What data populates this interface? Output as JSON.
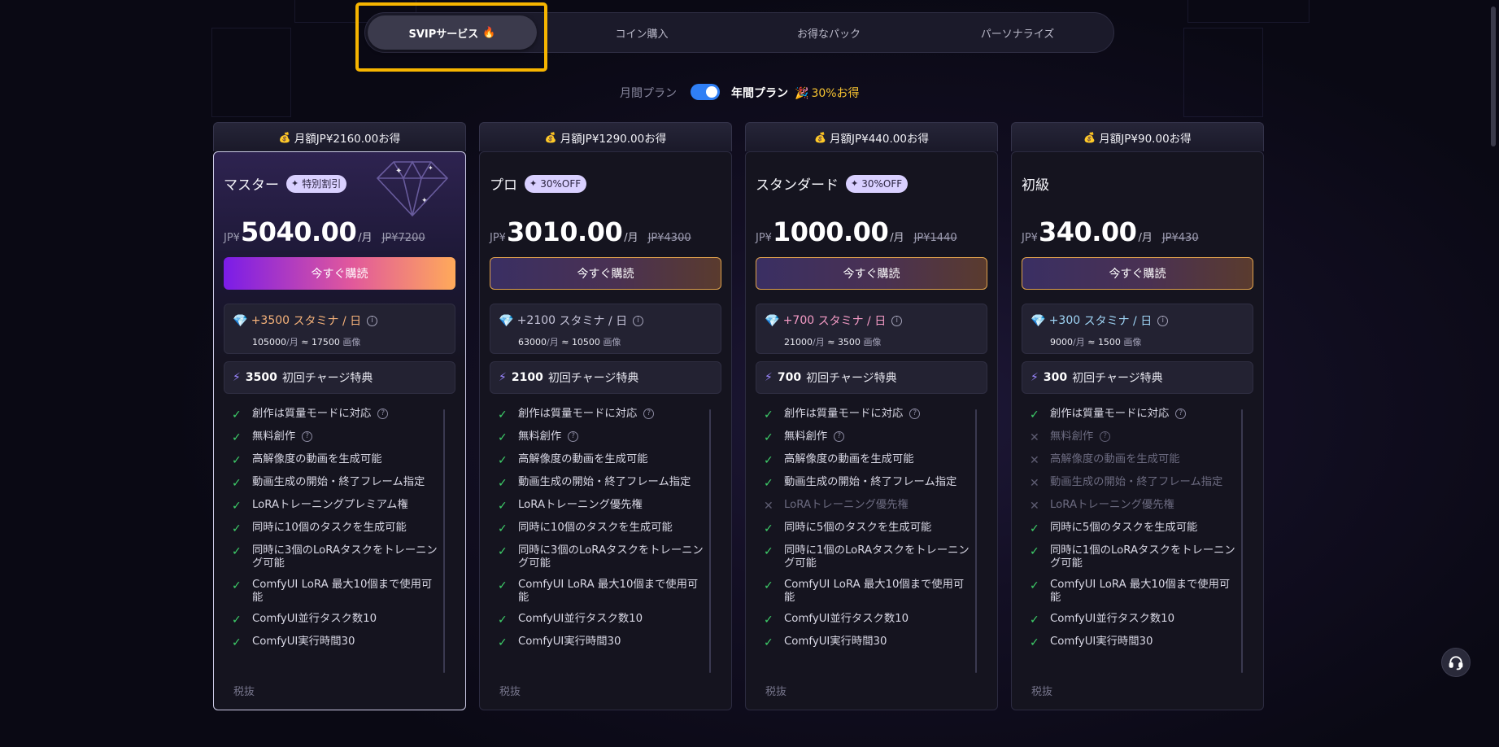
{
  "tabs": [
    {
      "label": "SVIPサービス",
      "icon": "fire-icon",
      "active": true
    },
    {
      "label": "コイン購入",
      "active": false
    },
    {
      "label": "お得なパック",
      "active": false
    },
    {
      "label": "パーソナライズ",
      "active": false
    }
  ],
  "billing": {
    "monthly_label": "月間プラン",
    "yearly_label": "年間プラン",
    "yearly_selected": true,
    "savings_text": "30%お得",
    "savings_icon": "party-popper-icon"
  },
  "common": {
    "per_month": "/月",
    "currency": "JP¥",
    "buy_label": "今すぐ購読",
    "stamina_label": "スタミナ / 日",
    "bonus_label": "初回チャージ特典",
    "tax_note": "税抜"
  },
  "plans": [
    {
      "savings_banner": "月額JP¥2160.00お得",
      "name": "マスター",
      "badge": "特別割引",
      "price": "5040.00",
      "original": "JP¥7200",
      "stamina": "+3500",
      "stamina_color": "#f5b27a",
      "stamina_detail_a": "105000",
      "stamina_detail_b": "17500",
      "images_unit": "画像",
      "bonus": "3500",
      "features": [
        {
          "text": "創作は質量モードに対応",
          "ok": true,
          "help": true
        },
        {
          "text": "無料創作",
          "ok": true,
          "help": true
        },
        {
          "text": "高解像度の動画を生成可能",
          "ok": true
        },
        {
          "text": "動画生成の開始・終了フレーム指定",
          "ok": true
        },
        {
          "text": "LoRAトレーニングプレミアム権",
          "ok": true
        },
        {
          "text": "同時に10個のタスクを生成可能",
          "ok": true
        },
        {
          "text": "同時に3個のLoRAタスクをトレーニング可能",
          "ok": true
        },
        {
          "text": "ComfyUI LoRA 最大10個まで使用可能",
          "ok": true
        },
        {
          "text": "ComfyUI並行タスク数10",
          "ok": true
        },
        {
          "text": "ComfyUI実行時間30",
          "ok": true
        }
      ]
    },
    {
      "savings_banner": "月額JP¥1290.00お得",
      "name": "プロ",
      "badge": "30%OFF",
      "price": "3010.00",
      "original": "JP¥4300",
      "stamina": "+2100",
      "stamina_color": "#c5c3d8",
      "stamina_detail_a": "63000",
      "stamina_detail_b": "10500",
      "images_unit": "画像",
      "bonus": "2100",
      "features": [
        {
          "text": "創作は質量モードに対応",
          "ok": true,
          "help": true
        },
        {
          "text": "無料創作",
          "ok": true,
          "help": true
        },
        {
          "text": "高解像度の動画を生成可能",
          "ok": true
        },
        {
          "text": "動画生成の開始・終了フレーム指定",
          "ok": true
        },
        {
          "text": "LoRAトレーニング優先権",
          "ok": true
        },
        {
          "text": "同時に10個のタスクを生成可能",
          "ok": true
        },
        {
          "text": "同時に3個のLoRAタスクをトレーニング可能",
          "ok": true
        },
        {
          "text": "ComfyUI LoRA 最大10個まで使用可能",
          "ok": true
        },
        {
          "text": "ComfyUI並行タスク数10",
          "ok": true
        },
        {
          "text": "ComfyUI実行時間30",
          "ok": true
        }
      ]
    },
    {
      "savings_banner": "月額JP¥440.00お得",
      "name": "スタンダード",
      "badge": "30%OFF",
      "price": "1000.00",
      "original": "JP¥1440",
      "stamina": "+700",
      "stamina_color": "#f59bc6",
      "stamina_detail_a": "21000",
      "stamina_detail_b": "3500",
      "images_unit": "画像",
      "bonus": "700",
      "features": [
        {
          "text": "創作は質量モードに対応",
          "ok": true,
          "help": true
        },
        {
          "text": "無料創作",
          "ok": true,
          "help": true
        },
        {
          "text": "高解像度の動画を生成可能",
          "ok": true
        },
        {
          "text": "動画生成の開始・終了フレーム指定",
          "ok": true
        },
        {
          "text": "LoRAトレーニング優先権",
          "ok": false
        },
        {
          "text": "同時に5個のタスクを生成可能",
          "ok": true
        },
        {
          "text": "同時に1個のLoRAタスクをトレーニング可能",
          "ok": true
        },
        {
          "text": "ComfyUI LoRA 最大10個まで使用可能",
          "ok": true
        },
        {
          "text": "ComfyUI並行タスク数10",
          "ok": true
        },
        {
          "text": "ComfyUI実行時間30",
          "ok": true
        }
      ]
    },
    {
      "savings_banner": "月額JP¥90.00お得",
      "name": "初級",
      "badge": "",
      "price": "340.00",
      "original": "JP¥430",
      "stamina": "+300",
      "stamina_color": "#9fd4f5",
      "stamina_detail_a": "9000",
      "stamina_detail_b": "1500",
      "images_unit": "画像",
      "bonus": "300",
      "features": [
        {
          "text": "創作は質量モードに対応",
          "ok": true,
          "help": true
        },
        {
          "text": "無料創作",
          "ok": false,
          "help": true
        },
        {
          "text": "高解像度の動画を生成可能",
          "ok": false
        },
        {
          "text": "動画生成の開始・終了フレーム指定",
          "ok": false
        },
        {
          "text": "LoRAトレーニング優先権",
          "ok": false
        },
        {
          "text": "同時に5個のタスクを生成可能",
          "ok": true
        },
        {
          "text": "同時に1個のLoRAタスクをトレーニング可能",
          "ok": true
        },
        {
          "text": "ComfyUI LoRA 最大10個まで使用可能",
          "ok": true
        },
        {
          "text": "ComfyUI並行タスク数10",
          "ok": true
        },
        {
          "text": "ComfyUI実行時間30",
          "ok": true
        }
      ]
    }
  ],
  "support": {
    "icon": "headset-icon"
  }
}
